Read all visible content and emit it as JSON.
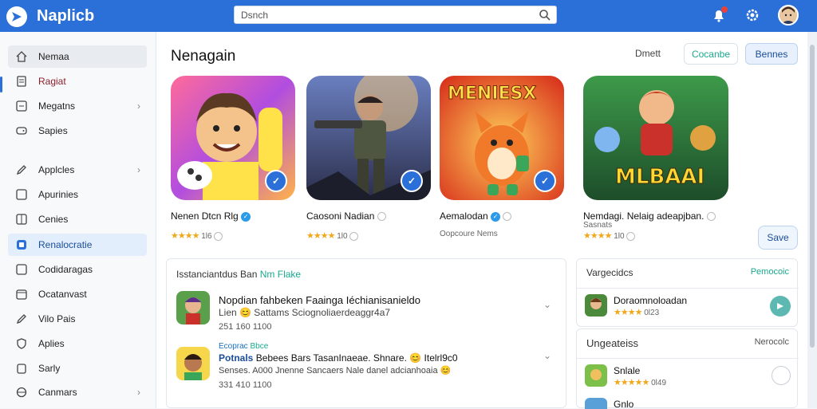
{
  "header": {
    "app_name": "Naplicb",
    "search_value": "Dsnch"
  },
  "sidebar": {
    "items": [
      {
        "label": "Nemaa"
      },
      {
        "label": "Ragiat"
      },
      {
        "label": "Megatns"
      },
      {
        "label": "Sapies"
      },
      {
        "label": "Applcles"
      },
      {
        "label": "Apurinies"
      },
      {
        "label": "Cenies"
      },
      {
        "label": "Renalocratie"
      },
      {
        "label": "Codidaragas"
      },
      {
        "label": "Ocatanvast"
      },
      {
        "label": "Vilo Pais"
      },
      {
        "label": "Aplies"
      },
      {
        "label": "Sarly"
      },
      {
        "label": "Canmars"
      }
    ]
  },
  "main": {
    "title": "Nenagain",
    "chips": [
      "Dmett",
      "Cocanbe",
      "Bennes"
    ],
    "featured": [
      {
        "title": "Nenen Dtcn Rlg",
        "sub": "",
        "rating": "1l6"
      },
      {
        "title": "Caosoni Nadian",
        "sub": "",
        "rating": "1l0"
      },
      {
        "title": "Aemalodan",
        "sub": "Oopcoure Nems",
        "rating": ""
      },
      {
        "title": "Nemdagi. Nelaig adeapjban.",
        "sub": "Sasnats",
        "rating": "1l0"
      }
    ],
    "card4_title_text": "MLBAAI",
    "card3_banner": "MENIESX",
    "save_button": "Save"
  },
  "recommend": {
    "header_prefix": "Isstanciantdus Ban",
    "header_accent": "Nm Flake",
    "rows": [
      {
        "line1": "Nopdian fahbeken Faainga Iéchianisanieldo",
        "line2": "Lien 😊 Sattams Sciognoliaerdeaggr4a7",
        "line3": "251 160 1100"
      },
      {
        "tag": "Ecoprac",
        "tag_accent": "Bbce",
        "line1_prefix": "Potnals",
        "line1": "Bebees Bars TasanInaeae. Shnare. 😊 Itelrl9c0",
        "line2": "Senses. A000 Jnenne Sancaers Nale danel adcianhoaia 😊",
        "line3": "331 410 1100"
      }
    ]
  },
  "right_panel_1": {
    "header": "Vargecidcs",
    "accent": "Pemocoic",
    "row_title": "Doraomnoloadan",
    "row_rating": "0l23"
  },
  "right_panel_2": {
    "header": "Ungeateiss",
    "accent": "Nerocolc",
    "rows": [
      {
        "title": "Snlale",
        "rating": "0l49"
      },
      {
        "title": "Gnlo",
        "rating": ""
      }
    ]
  },
  "colors": {
    "brand": "#2b6fd8",
    "accent_teal": "#1aa88e",
    "star": "#f0a81c"
  }
}
